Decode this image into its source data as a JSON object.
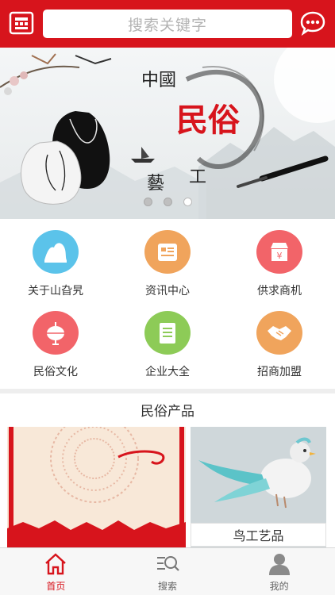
{
  "header": {
    "search_placeholder": "搜索关键字",
    "scan_icon": "scan-icon",
    "message_icon": "message-icon"
  },
  "banner": {
    "text_top": "中國",
    "text_main": "民俗",
    "text_side_1": "工",
    "text_side_2": "藝",
    "slide_count": 3,
    "active_slide": 3
  },
  "categories": [
    {
      "label": "关于山旮旯",
      "icon": "mountain-icon",
      "color": "#5bc3ea"
    },
    {
      "label": "资讯中心",
      "icon": "newspaper-icon",
      "color": "#f0a45c"
    },
    {
      "label": "供求商机",
      "icon": "shop-icon",
      "color": "#f26469"
    },
    {
      "label": "民俗文化",
      "icon": "lantern-icon",
      "color": "#f26469"
    },
    {
      "label": "企业大全",
      "icon": "document-icon",
      "color": "#8dcb57"
    },
    {
      "label": "招商加盟",
      "icon": "handshake-icon",
      "color": "#f0a45c"
    }
  ],
  "section": {
    "title": "民俗产品"
  },
  "products": [
    {
      "label": ""
    },
    {
      "label": "鸟工艺品"
    }
  ],
  "tabbar": [
    {
      "label": "首页",
      "icon": "home-icon",
      "active": true
    },
    {
      "label": "搜索",
      "icon": "search-icon",
      "active": false
    },
    {
      "label": "我的",
      "icon": "user-icon",
      "active": false
    }
  ],
  "colors": {
    "brand": "#d7141c",
    "accent_text": "#d7141c"
  }
}
